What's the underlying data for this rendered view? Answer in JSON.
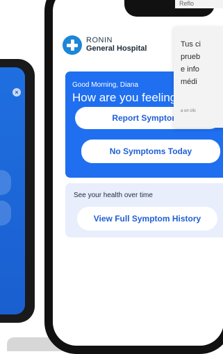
{
  "brand": {
    "top": "RONIN",
    "bottom": "General Hospital"
  },
  "checkin": {
    "greeting": "Good Morning, Diana",
    "question": "How are you feeling",
    "report_button": "Report Symptoms",
    "none_button": "No Symptoms Today"
  },
  "history": {
    "label": "See your health over time",
    "button": "View Full Symptom History"
  },
  "overlay": {
    "top_text": "Reflo",
    "lines": [
      "Tus ci",
      "prueb",
      "e info",
      "médi"
    ],
    "footer": "a un clic"
  },
  "colors": {
    "accent": "#1f6ff0",
    "light_card": "#e8eefc",
    "logo": "#1c86d8"
  },
  "icons": {
    "logo": "medical-cross-icon",
    "close": "close-icon"
  }
}
